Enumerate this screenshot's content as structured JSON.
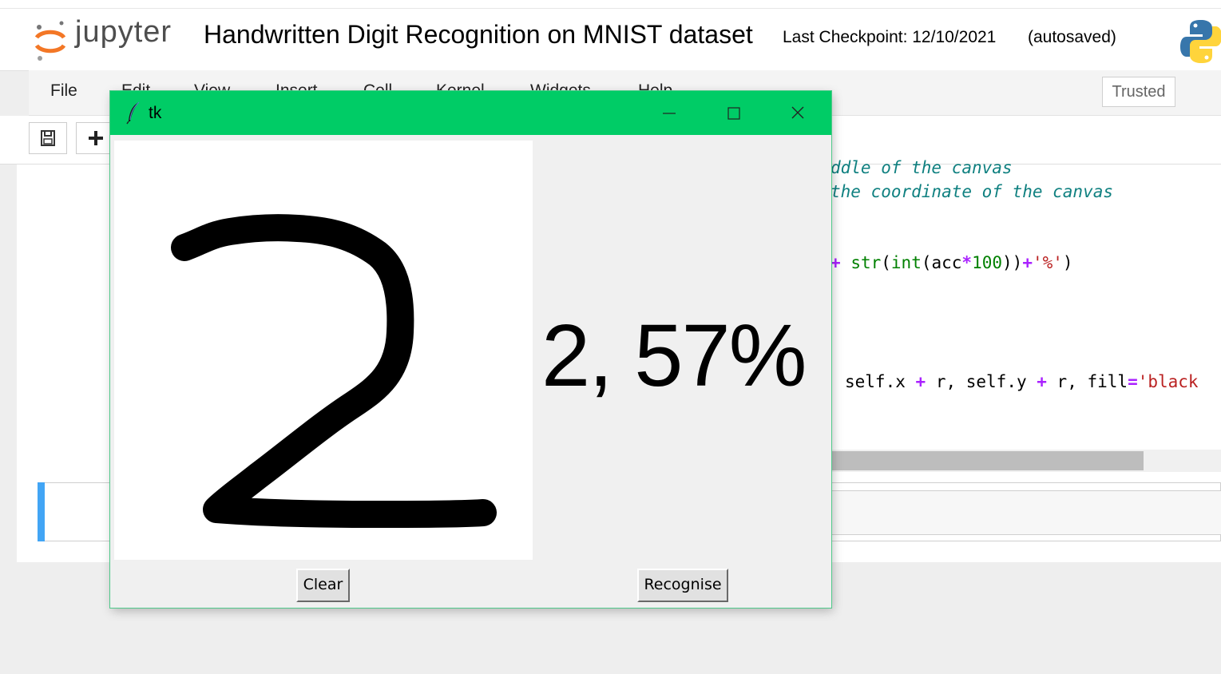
{
  "app": {
    "logo_text": "jupyter",
    "notebook_title": "Handwritten Digit Recognition on MNIST dataset",
    "checkpoint": "Last Checkpoint: 12/10/2021",
    "autosave_status": "(autosaved)",
    "trusted_label": "Trusted"
  },
  "menu": {
    "items": [
      "File",
      "Edit",
      "View",
      "Insert",
      "Cell",
      "Kernel",
      "Widgets",
      "Help"
    ]
  },
  "code": {
    "line1_comment": "ddle of the canvas",
    "line2_comment": "the coordinate of the canvas",
    "line3": {
      "op": "+",
      "fn1": "str",
      "p1": "(",
      "fn2": "int",
      "p2": "(acc",
      "op2": "*",
      "num": "100",
      "p3": "))",
      "op3": "+",
      "str": "'%'",
      "p4": ")"
    },
    "line4": {
      "a": "self.x ",
      "op1": "+",
      "b": " r, self.y ",
      "op2": "+",
      "c": " r, fill",
      "eq": "=",
      "str": "'black"
    }
  },
  "tk": {
    "window_title": "tk",
    "result_text": "2, 57%",
    "clear_label": "Clear",
    "recognise_label": "Recognise",
    "titlebar_color": "#00cc66"
  }
}
